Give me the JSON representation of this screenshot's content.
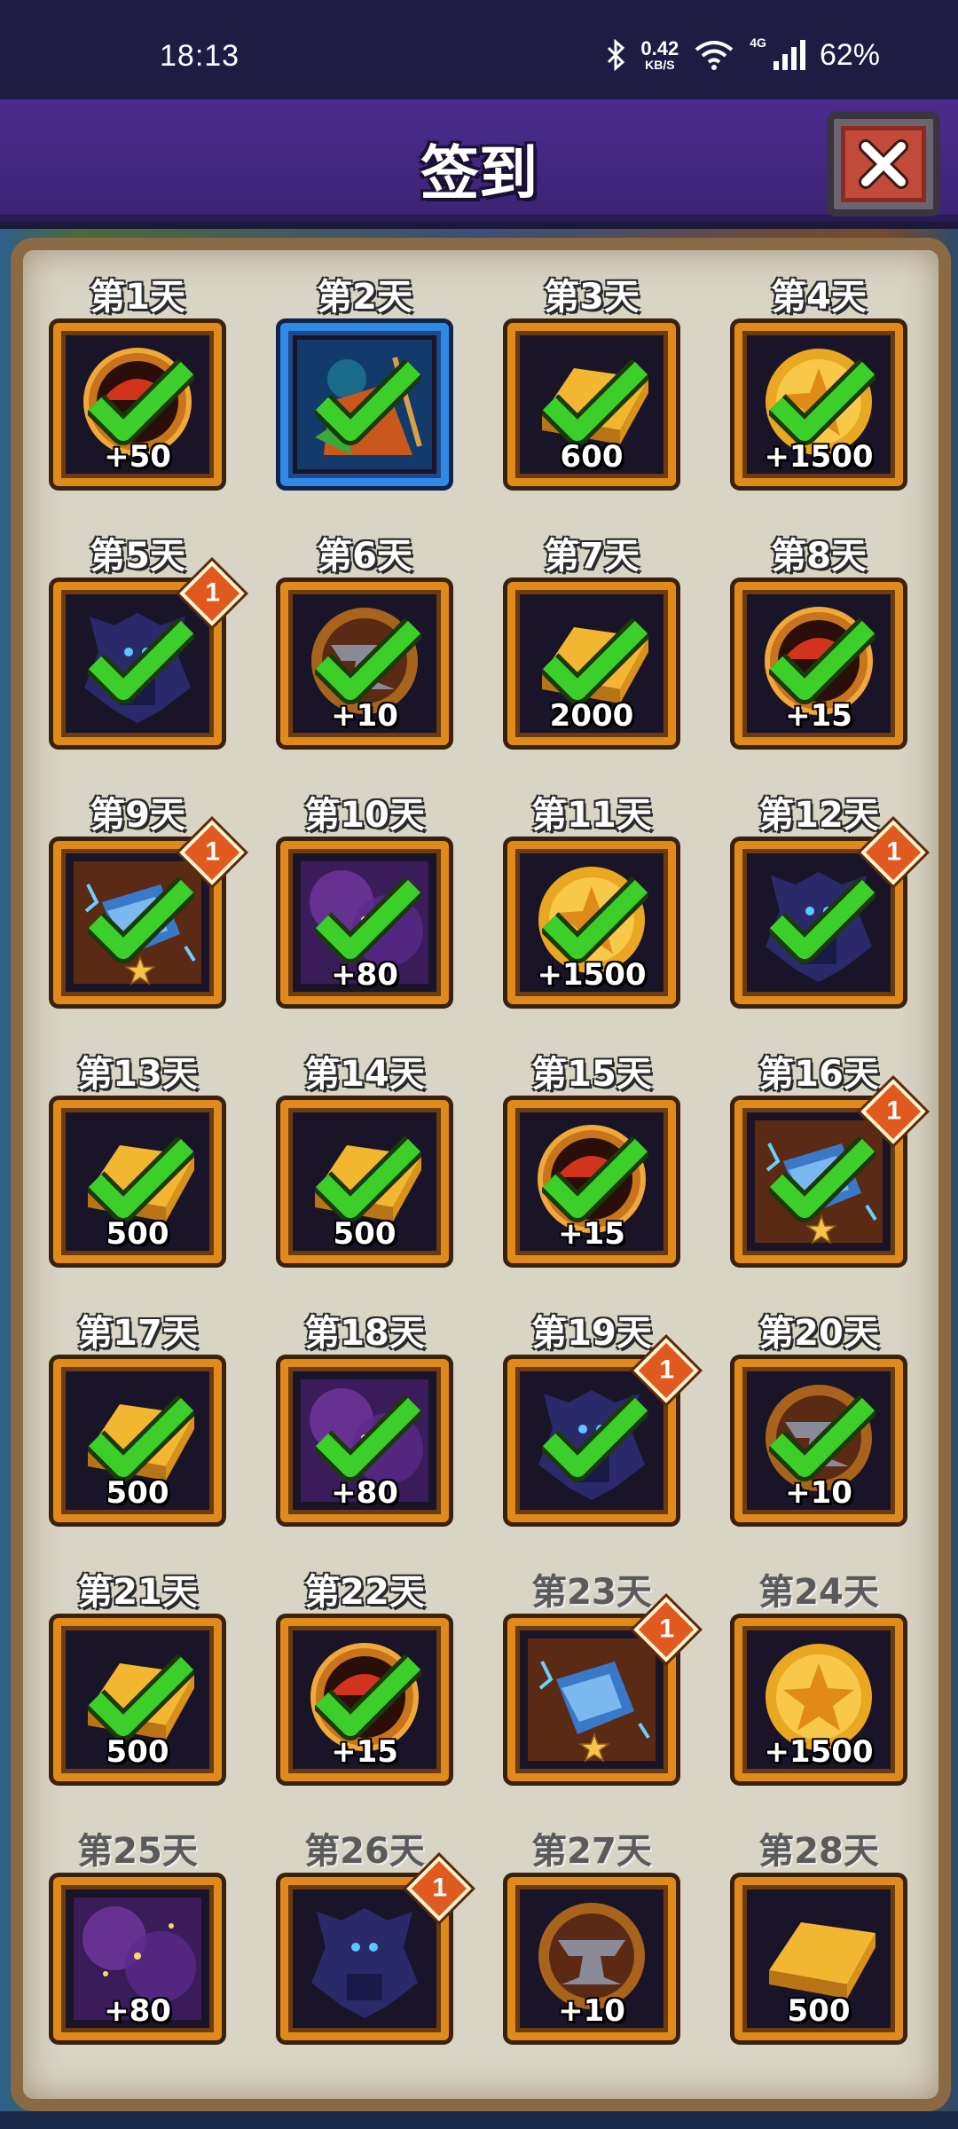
{
  "status_bar": {
    "time": "18:13",
    "netspeed_value": "0.42",
    "netspeed_unit": "KB/S",
    "network_type": "4G",
    "battery": "62%"
  },
  "header": {
    "title": "签到",
    "close_icon": "close-x-icon"
  },
  "colors": {
    "header_bg": "#3b2475",
    "tile_border": "#e18a1c",
    "tile_border_highlight": "#2f8ae6",
    "check_green": "#3ccf2a",
    "badge_orange": "#e05a20"
  },
  "days": [
    {
      "label": "第1天",
      "amount": "+50",
      "item": "fire-orb",
      "claimed": true
    },
    {
      "label": "第2天",
      "amount": "",
      "item": "hero-portrait",
      "claimed": true,
      "highlight": true
    },
    {
      "label": "第3天",
      "amount": "600",
      "item": "gold-bar",
      "claimed": true
    },
    {
      "label": "第4天",
      "amount": "+1500",
      "item": "gold-coin",
      "claimed": true
    },
    {
      "label": "第5天",
      "amount": "",
      "item": "dark-dragon",
      "claimed": true,
      "badge": "1"
    },
    {
      "label": "第6天",
      "amount": "+10",
      "item": "anvil",
      "claimed": true
    },
    {
      "label": "第7天",
      "amount": "2000",
      "item": "gold-bar",
      "claimed": true
    },
    {
      "label": "第8天",
      "amount": "+15",
      "item": "fire-orb",
      "claimed": true
    },
    {
      "label": "第9天",
      "amount": "",
      "item": "gauntlet",
      "claimed": true,
      "badge": "1",
      "star": true
    },
    {
      "label": "第10天",
      "amount": "+80",
      "item": "galaxy",
      "claimed": true
    },
    {
      "label": "第11天",
      "amount": "+1500",
      "item": "gold-coin",
      "claimed": true
    },
    {
      "label": "第12天",
      "amount": "",
      "item": "dark-dragon",
      "claimed": true,
      "badge": "1"
    },
    {
      "label": "第13天",
      "amount": "500",
      "item": "gold-bar",
      "claimed": true
    },
    {
      "label": "第14天",
      "amount": "500",
      "item": "gold-bar",
      "claimed": true
    },
    {
      "label": "第15天",
      "amount": "+15",
      "item": "fire-orb",
      "claimed": true
    },
    {
      "label": "第16天",
      "amount": "",
      "item": "gauntlet",
      "claimed": true,
      "badge": "1",
      "star": true
    },
    {
      "label": "第17天",
      "amount": "500",
      "item": "gold-bar",
      "claimed": true
    },
    {
      "label": "第18天",
      "amount": "+80",
      "item": "galaxy",
      "claimed": true
    },
    {
      "label": "第19天",
      "amount": "",
      "item": "dark-dragon",
      "claimed": true,
      "badge": "1"
    },
    {
      "label": "第20天",
      "amount": "+10",
      "item": "anvil",
      "claimed": true
    },
    {
      "label": "第21天",
      "amount": "500",
      "item": "gold-bar",
      "claimed": true
    },
    {
      "label": "第22天",
      "amount": "+15",
      "item": "fire-orb",
      "claimed": true
    },
    {
      "label": "第23天",
      "amount": "",
      "item": "gauntlet",
      "claimed": false,
      "badge": "1",
      "star": true
    },
    {
      "label": "第24天",
      "amount": "+1500",
      "item": "gold-coin",
      "claimed": false
    },
    {
      "label": "第25天",
      "amount": "+80",
      "item": "galaxy",
      "claimed": false
    },
    {
      "label": "第26天",
      "amount": "",
      "item": "dark-dragon",
      "claimed": false,
      "badge": "1"
    },
    {
      "label": "第27天",
      "amount": "+10",
      "item": "anvil",
      "claimed": false
    },
    {
      "label": "第28天",
      "amount": "500",
      "item": "gold-bar",
      "claimed": false
    }
  ]
}
